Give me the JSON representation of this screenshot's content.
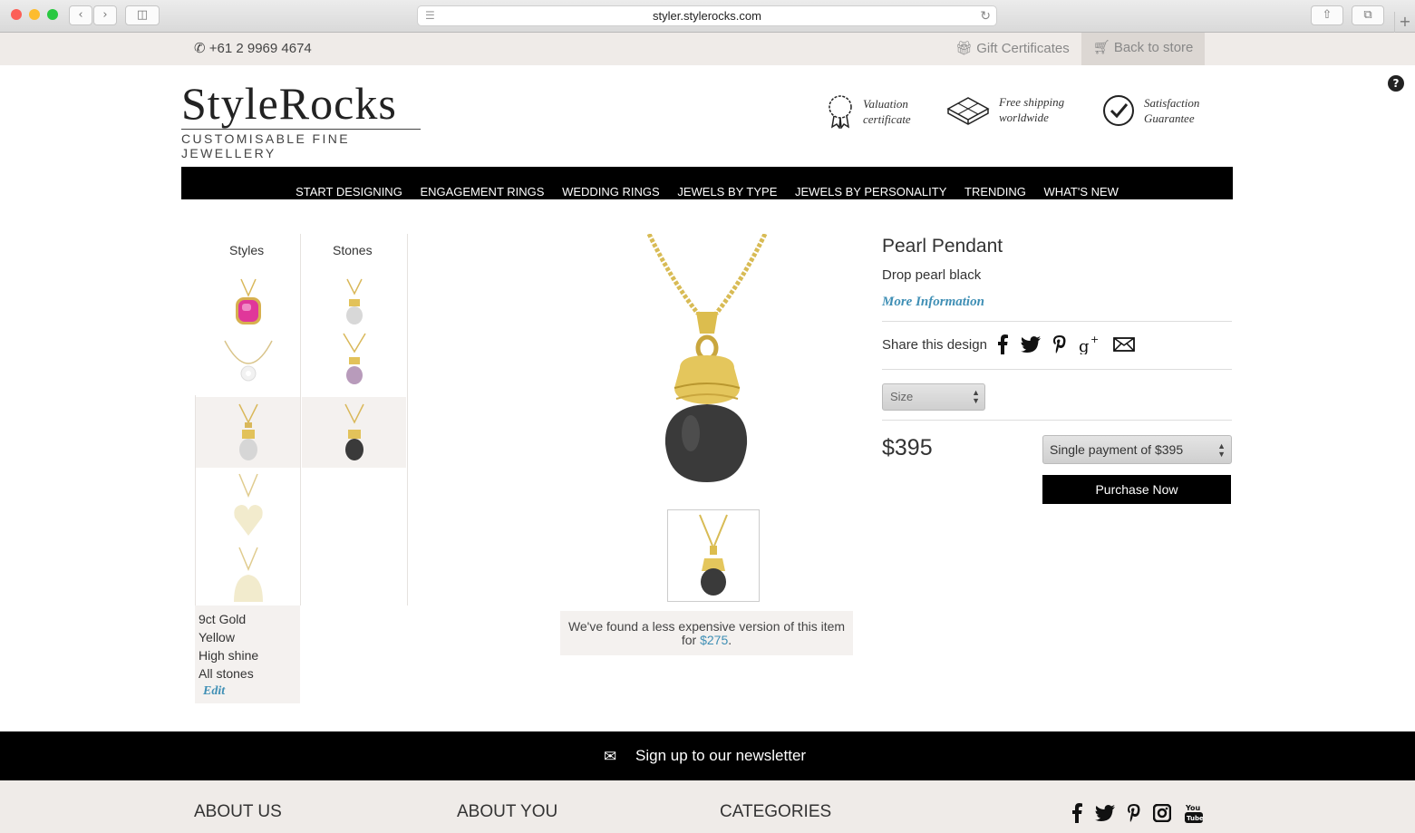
{
  "browser": {
    "url": "styler.stylerocks.com"
  },
  "topbar": {
    "phone": "+61 2 9969 4674",
    "gift_certificates": "Gift Certificates",
    "back_to_store": "Back to store"
  },
  "header": {
    "logo_main": "StyleRocks",
    "logo_tagline": "CUSTOMISABLE FINE JEWELLERY",
    "badges": [
      {
        "line1": "Valuation",
        "line2": "certificate",
        "icon": "ribbon-icon"
      },
      {
        "line1": "Free shipping",
        "line2": "worldwide",
        "icon": "gift-box-icon"
      },
      {
        "line1": "Satisfaction",
        "line2": "Guarantee",
        "icon": "check-circle-icon"
      }
    ]
  },
  "nav": {
    "items": [
      "START DESIGNING",
      "ENGAGEMENT RINGS",
      "WEDDING RINGS",
      "JEWELS BY TYPE",
      "JEWELS BY PERSONALITY",
      "TRENDING",
      "WHAT'S NEW"
    ]
  },
  "customizer": {
    "styles_heading": "Styles",
    "stones_heading": "Stones",
    "summary": {
      "metal": "9ct Gold",
      "colour": "Yellow",
      "finish": "High shine",
      "stones": "All stones",
      "edit": "Edit"
    }
  },
  "product": {
    "title": "Pearl Pendant",
    "variant": "Drop pearl black",
    "more_info": "More Information",
    "share_label": "Share this design",
    "size_label": "Size",
    "price": "$395",
    "payment_option": "Single payment of $395",
    "purchase": "Purchase Now",
    "cheaper_text": "We've found a less expensive version of this item for",
    "cheaper_price": "$275",
    "cheaper_end": "."
  },
  "newsletter": {
    "label": "Sign up to our newsletter"
  },
  "footer": {
    "about_us": "ABOUT US",
    "about_you": "ABOUT YOU",
    "categories": "CATEGORIES"
  },
  "colors": {
    "accent": "#3f8fb5",
    "gold": "#e9d27a",
    "nav_bg": "#000000",
    "beige": "#efebe8"
  }
}
